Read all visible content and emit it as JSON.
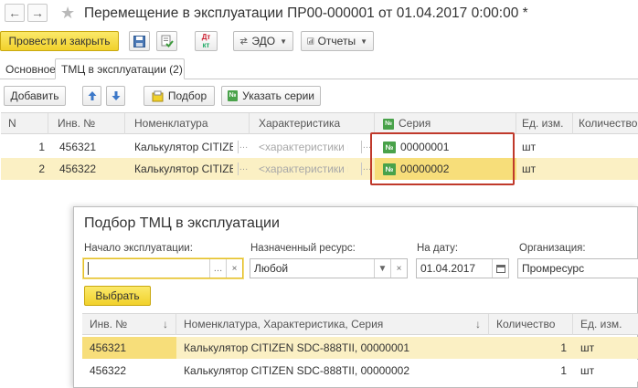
{
  "window": {
    "title": "Перемещение в эксплуатации ПР00-000001 от 01.04.2017 0:00:00 *",
    "back_icon": "arrow-left-icon",
    "forward_icon": "arrow-right-icon",
    "favorite_icon": "star-icon"
  },
  "toolbar": {
    "post_close_label": "Провести и закрыть",
    "save_icon": "floppy-icon",
    "post_icon": "post-document-icon",
    "dtkt_line1": "Дт",
    "dtkt_line2": "кт",
    "edo_label": "ЭДО",
    "reports_label": "Отчеты"
  },
  "tabs": [
    {
      "label": "Основное",
      "active": false
    },
    {
      "label": "ТМЦ в эксплуатации (2)",
      "active": true
    }
  ],
  "table_toolbar": {
    "add_label": "Добавить",
    "pick_label": "Подбор",
    "series_label": "Указать серии",
    "series_icon_text": "№"
  },
  "table": {
    "columns": [
      "N",
      "Инв. №",
      "Номенклатура",
      "Характеристика",
      "Серия",
      "Ед. изм.",
      "Количество"
    ],
    "series_icon_text": "№",
    "rows": [
      {
        "n": "1",
        "inv": "456321",
        "nomenclature": "Калькулятор CITIZEN ...",
        "characteristic": "<характеристики не ...",
        "series": "00000001",
        "unit": "шт",
        "qty": ""
      },
      {
        "n": "2",
        "inv": "456322",
        "nomenclature": "Калькулятор CITIZEN ...",
        "characteristic": "<характеристики не ...",
        "series": "00000002",
        "unit": "шт",
        "qty": ""
      }
    ]
  },
  "popup": {
    "title": "Подбор ТМЦ в эксплуатации",
    "start_label": "Начало эксплуатации:",
    "start_value": "",
    "resource_label": "Назначенный ресурс:",
    "resource_value": "Любой",
    "date_label": "На дату:",
    "date_value": "01.04.2017",
    "org_label": "Организация:",
    "org_value": "Промресурс",
    "select_label": "Выбрать",
    "columns": [
      "Инв. №",
      "Номенклатура, Характеристика, Серия",
      "Количество",
      "Ед. изм."
    ],
    "rows": [
      {
        "inv": "456321",
        "name": "Калькулятор CITIZEN SDC-888TII, 00000001",
        "qty": "1",
        "unit": "шт"
      },
      {
        "inv": "456322",
        "name": "Калькулятор CITIZEN SDC-888TII, 00000002",
        "qty": "1",
        "unit": "шт"
      }
    ]
  },
  "colors": {
    "primary_button": "#f1d12b",
    "selected_row": "#fbf0c4",
    "highlight_border": "#c0392b",
    "series_icon": "#49a24a"
  }
}
